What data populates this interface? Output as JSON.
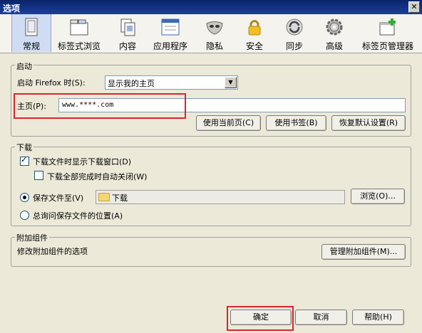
{
  "window": {
    "title": "选项",
    "close_glyph": "✕"
  },
  "tabs": [
    {
      "label": "常规",
      "icon": "general-icon"
    },
    {
      "label": "标签式浏览",
      "icon": "tabs-icon"
    },
    {
      "label": "内容",
      "icon": "content-icon"
    },
    {
      "label": "应用程序",
      "icon": "applications-icon"
    },
    {
      "label": "隐私",
      "icon": "privacy-mask-icon"
    },
    {
      "label": "安全",
      "icon": "lock-icon"
    },
    {
      "label": "同步",
      "icon": "sync-icon"
    },
    {
      "label": "高级",
      "icon": "gear-icon"
    },
    {
      "label": "标签页管理器",
      "icon": "tab-manager-icon"
    }
  ],
  "startup": {
    "group_label": "启动",
    "when_label": "启动 Firefox 时(S):",
    "when_value": "显示我的主页",
    "homepage_label": "主页(P):",
    "homepage_value": "www.****.com",
    "use_current_label": "使用当前页(C)",
    "use_bookmark_label": "使用书签(B)",
    "restore_default_label": "恢复默认设置(R)"
  },
  "downloads": {
    "group_label": "下载",
    "show_window_label": "下载文件时显示下载窗口(D)",
    "show_window_checked": true,
    "close_when_done_label": "下载全部完成时自动关闭(W)",
    "close_when_done_checked": false,
    "save_to_label": "保存文件至(V)",
    "save_to_path": "下载",
    "browse_label": "浏览(O)...",
    "always_ask_label": "总询问保存文件的位置(A)"
  },
  "addons": {
    "group_label": "附加组件",
    "description": "修改附加组件的选项",
    "manage_label": "管理附加组件(M)..."
  },
  "footer": {
    "ok_label": "确定",
    "cancel_label": "取消",
    "help_label": "帮助(H)"
  },
  "colors": {
    "highlight_red": "#d9262c",
    "title_bar": "#0a246a",
    "selected_tab": "#cfdcf3"
  }
}
